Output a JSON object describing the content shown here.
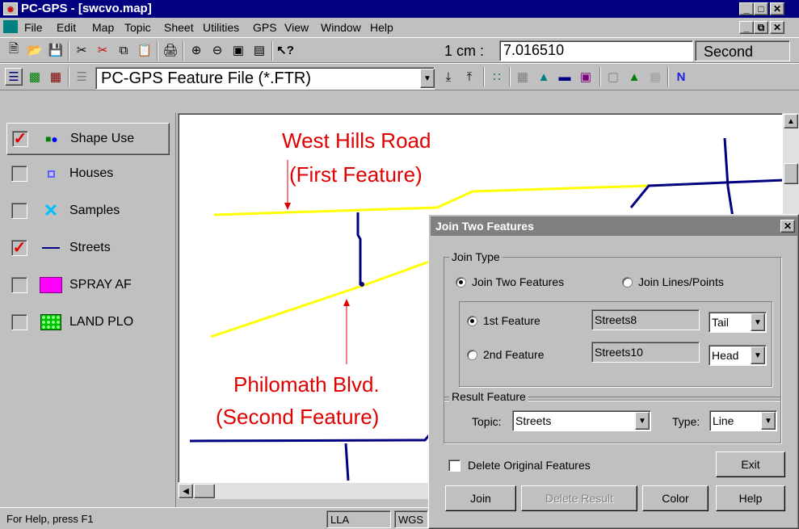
{
  "window": {
    "title": "PC-GPS - [swcvo.map]"
  },
  "menu": [
    "File",
    "Edit",
    "Map",
    "Topic",
    "Sheet",
    "Utilities",
    "GPS",
    "View",
    "Window",
    "Help"
  ],
  "toolbar1": {
    "scale_label": "1 cm :",
    "scale_value": "7.016510",
    "unit": "Second"
  },
  "toolbar2": {
    "filetype": "PC-GPS Feature File (*.FTR)"
  },
  "layers": [
    {
      "label": "Shape Use",
      "checked": true
    },
    {
      "label": "Houses",
      "checked": false
    },
    {
      "label": "Samples",
      "checked": false
    },
    {
      "label": "Streets",
      "checked": true
    },
    {
      "label": "SPRAY AF",
      "checked": false
    },
    {
      "label": "LAND PLO",
      "checked": false
    }
  ],
  "annotations": {
    "first_line1": "West Hills Road",
    "first_line2": "(First Feature)",
    "second_line1": "Philomath Blvd.",
    "second_line2": "(Second Feature)"
  },
  "status": {
    "help": "For Help, press F1",
    "mode": "LLA",
    "datum": "WGS"
  },
  "dialog": {
    "title": "Join Two Features",
    "join_type_label": "Join Type",
    "join_two_features": "Join Two Features",
    "join_lines_points": "Join Lines/Points",
    "first_feature_label": "1st Feature",
    "first_feature_value": "Streets8",
    "first_end": "Tail",
    "second_feature_label": "2nd Feature",
    "second_feature_value": "Streets10",
    "second_end": "Head",
    "result_label": "Result Feature",
    "topic_label": "Topic:",
    "topic_value": "Streets",
    "type_label": "Type:",
    "type_value": "Line",
    "delete_original": "Delete Original Features",
    "exit": "Exit",
    "join": "Join",
    "delete_result": "Delete Result",
    "color": "Color",
    "help": "Help"
  },
  "colors": {
    "titlebar": "#000080",
    "annotation": "#e00000",
    "street": "#000080",
    "road": "#ffff00"
  }
}
